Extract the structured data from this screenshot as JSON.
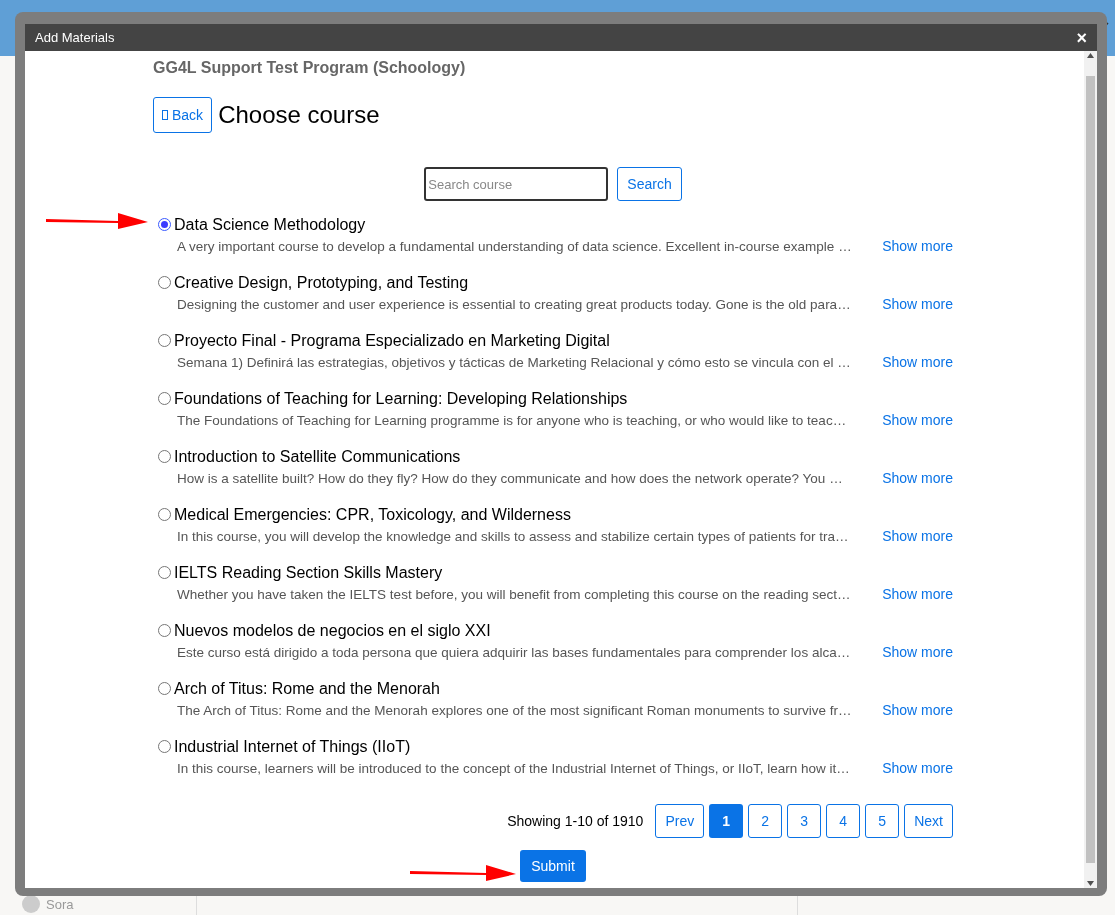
{
  "window": {
    "title": "Add Materials",
    "close": "×"
  },
  "header": {
    "program": "GG4L Support Test Program (Schoology)",
    "back": "Back",
    "heading": "Choose course"
  },
  "search": {
    "placeholder": "Search course",
    "button": "Search"
  },
  "courses": [
    {
      "title": "Data Science Methodology",
      "description": "A very important course to develop a fundamental understanding of data science. Excellent in-course example …",
      "selected": true,
      "link": "Show more"
    },
    {
      "title": "Creative Design, Prototyping, and Testing",
      "description": "Designing the customer and user experience is essential to creating great products today. Gone is the old para…",
      "selected": false,
      "link": "Show more"
    },
    {
      "title": "Proyecto Final - Programa Especializado en Marketing Digital",
      "description": "Semana 1) Definirá las estrategias, objetivos y tácticas de Marketing Relacional y cómo esto se vincula con el …",
      "selected": false,
      "link": "Show more"
    },
    {
      "title": "Foundations of Teaching for Learning: Developing Relationships",
      "description": "The Foundations of Teaching for Learning programme is for anyone who is teaching, or who would like to teac…",
      "selected": false,
      "link": "Show more"
    },
    {
      "title": "Introduction to Satellite Communications",
      "description": "How is a satellite built? How do they fly? How do they communicate and how does the network operate? You …",
      "selected": false,
      "link": "Show more"
    },
    {
      "title": "Medical Emergencies: CPR, Toxicology, and Wilderness",
      "description": "In this course, you will develop the knowledge and skills to assess and stabilize certain types of patients for tra…",
      "selected": false,
      "link": "Show more"
    },
    {
      "title": "IELTS Reading Section Skills Mastery",
      "description": "Whether you have taken the IELTS test before, you will benefit from completing this course on the reading sect…",
      "selected": false,
      "link": "Show more"
    },
    {
      "title": "Nuevos modelos de negocios en el siglo XXI",
      "description": "Este curso está dirigido a toda persona que quiera adquirir las bases fundamentales para comprender los alca…",
      "selected": false,
      "link": "Show more"
    },
    {
      "title": "Arch of Titus: Rome and the Menorah",
      "description": "The Arch of Titus: Rome and the Menorah explores one of the most significant Roman monuments to survive fr…",
      "selected": false,
      "link": "Show more"
    },
    {
      "title": "Industrial Internet of Things (IIoT)",
      "description": "In this course, learners will be introduced to the concept of the Industrial Internet of Things, or IIoT, learn how it…",
      "selected": false,
      "link": "Show more"
    }
  ],
  "pagination": {
    "summary": "Showing 1-10 of 1910",
    "prev": "Prev",
    "next": "Next",
    "pages": [
      {
        "label": "1",
        "selected": true
      },
      {
        "label": "2",
        "selected": false
      },
      {
        "label": "3",
        "selected": false
      },
      {
        "label": "4",
        "selected": false
      },
      {
        "label": "5",
        "selected": false
      }
    ]
  },
  "submit": "Submit",
  "background": {
    "sidebar_item": "Sora"
  }
}
